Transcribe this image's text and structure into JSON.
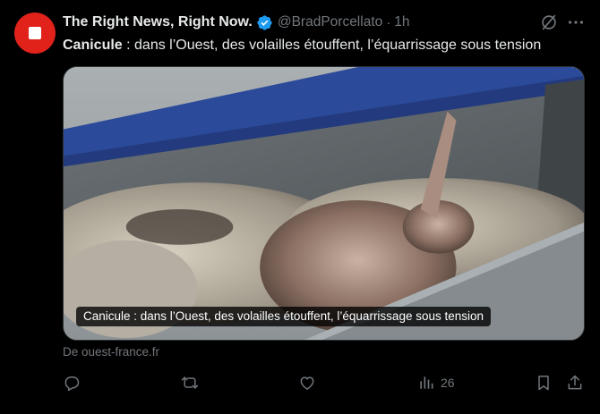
{
  "tweet": {
    "author": {
      "display_name": "The Right News, Right Now.",
      "handle": "@BradPorcellato",
      "verified": true
    },
    "separator": "·",
    "time": "1h",
    "text_bold": "Canicule",
    "text_rest": " : dans l’Ouest, des volailles étouffent, l’équarrissage sous tension",
    "card": {
      "caption": "Canicule : dans l’Ouest, des volailles étouffent, l’équarrissage sous tension",
      "source": "De ouest-france.fr"
    },
    "actions": {
      "reply": "reply-icon",
      "repost": "repost-icon",
      "like": "like-icon",
      "views_icon": "views-icon",
      "views_count": "26",
      "bookmark": "bookmark-icon",
      "share": "share-icon"
    }
  },
  "colors": {
    "background": "#000000",
    "text": "#e7e9ea",
    "muted": "#71767b",
    "verified": "#1d9bf0",
    "avatar": "#e0221b"
  }
}
